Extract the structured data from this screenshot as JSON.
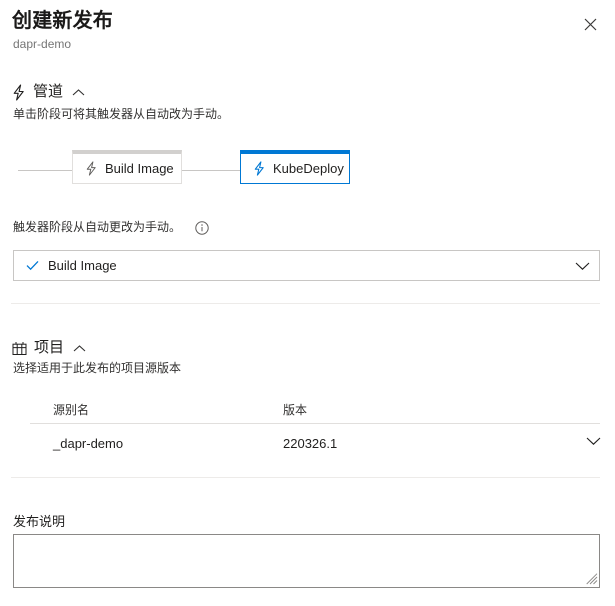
{
  "header": {
    "title": "创建新发布",
    "subtitle": "dapr-demo",
    "close_label": "关闭"
  },
  "pipeline_section": {
    "title": "管道",
    "icon": "lightning-bolt-icon",
    "collapse_icon": "chevron-up-icon",
    "description": "单击阶段可将其触发器从自动改为手动。",
    "stages": [
      {
        "name": "Build Image",
        "icon": "lightning-bolt-icon",
        "selected": false
      },
      {
        "name": "KubeDeploy",
        "icon": "lightning-bolt-icon",
        "selected": true
      }
    ],
    "trigger_label": "触发器阶段从自动更改为手动。",
    "info_icon": "info-circle-icon",
    "dropdown": {
      "value": "Build Image",
      "check_icon": "checkmark-icon",
      "chevron_icon": "chevron-down-icon"
    }
  },
  "artifacts_section": {
    "title": "项目",
    "icon": "package-icon",
    "collapse_icon": "chevron-up-icon",
    "description": "选择适用于此发布的项目源版本",
    "columns": [
      "源别名",
      "版本"
    ],
    "rows": [
      {
        "alias": "_dapr-demo",
        "version": "220326.1",
        "chevron_icon": "chevron-down-icon"
      }
    ]
  },
  "release_notes": {
    "label": "发布说明",
    "value": "",
    "placeholder": ""
  },
  "colors": {
    "accent": "#0078d4",
    "border": "#c8c6c4",
    "divider": "#edebe9",
    "text": "#201f1e",
    "muted": "#767676"
  }
}
